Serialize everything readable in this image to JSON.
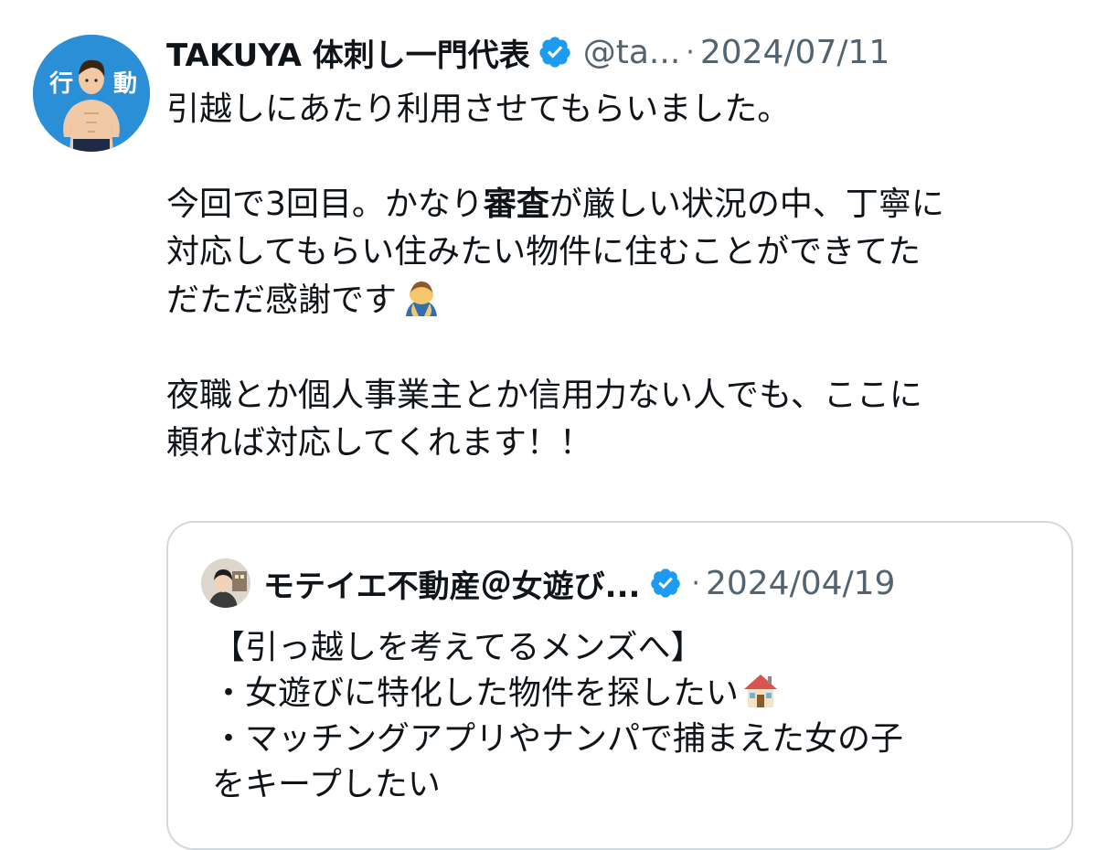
{
  "tweet": {
    "author_name": "TAKUYA 体刺し一門代表",
    "handle": "@ta...",
    "separator": "·",
    "date": "2024/07/11",
    "lines": [
      "引越しにあたり利用させてもらいました。",
      "",
      "今回で3回目。かなり",
      "が厳しい状況の中、丁寧に",
      "対応してもらい住みたい物件に住むことができてた",
      "だただ感謝です",
      "",
      "夜職とか個人事業主とか信用力ない人でも、ここに",
      "頼れば対応してくれます！！"
    ],
    "bold_word": "審査",
    "avatar_text_left": "行",
    "avatar_text_right": "動",
    "icons": [
      "verified-badge-icon",
      "person-bowing-emoji"
    ]
  },
  "quote": {
    "author_name": "モテイエ不動産＠女遊び...",
    "separator": "·",
    "date": "2024/04/19",
    "lines": [
      "【引っ越しを考えてるメンズへ】",
      "・女遊びに特化した物件を探したい",
      "・マッチングアプリやナンパで捕まえた女の子",
      "をキープしたい"
    ],
    "icons": [
      "verified-badge-icon",
      "house-emoji"
    ]
  },
  "colors": {
    "verified": "#1d9bf0",
    "secondary_text": "#536471",
    "border": "#cfd9de",
    "avatar_bg": "#2a8fd6"
  }
}
